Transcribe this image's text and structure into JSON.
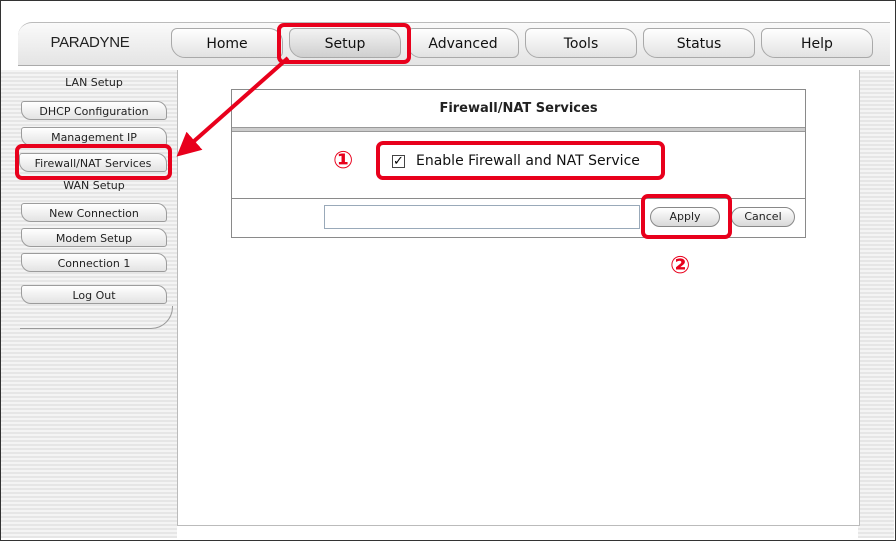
{
  "logo": {
    "text": "PARADYNE"
  },
  "nav": {
    "tabs": [
      {
        "label": "Home"
      },
      {
        "label": "Setup"
      },
      {
        "label": "Advanced"
      },
      {
        "label": "Tools"
      },
      {
        "label": "Status"
      },
      {
        "label": "Help"
      }
    ],
    "active": "Setup"
  },
  "sidebar": {
    "lan_header": "LAN Setup",
    "dhcp": "DHCP Configuration",
    "management_ip": "Management IP",
    "firewall_nat": "Firewall/NAT Services",
    "wan_header": "WAN Setup",
    "new_connection": "New Connection",
    "modem_setup": "Modem Setup",
    "connection_1": "Connection 1",
    "log_out": "Log Out"
  },
  "panel": {
    "title": "Firewall/NAT Services",
    "checkbox_label": "Enable Firewall and NAT Service",
    "checkbox_checked": true,
    "checkbox_mark": "✓",
    "apply_field_value": "",
    "apply_label": "Apply",
    "cancel_label": "Cancel"
  },
  "annotations": {
    "step1": "①",
    "step2": "②",
    "highlight_color": "#e8001c"
  }
}
